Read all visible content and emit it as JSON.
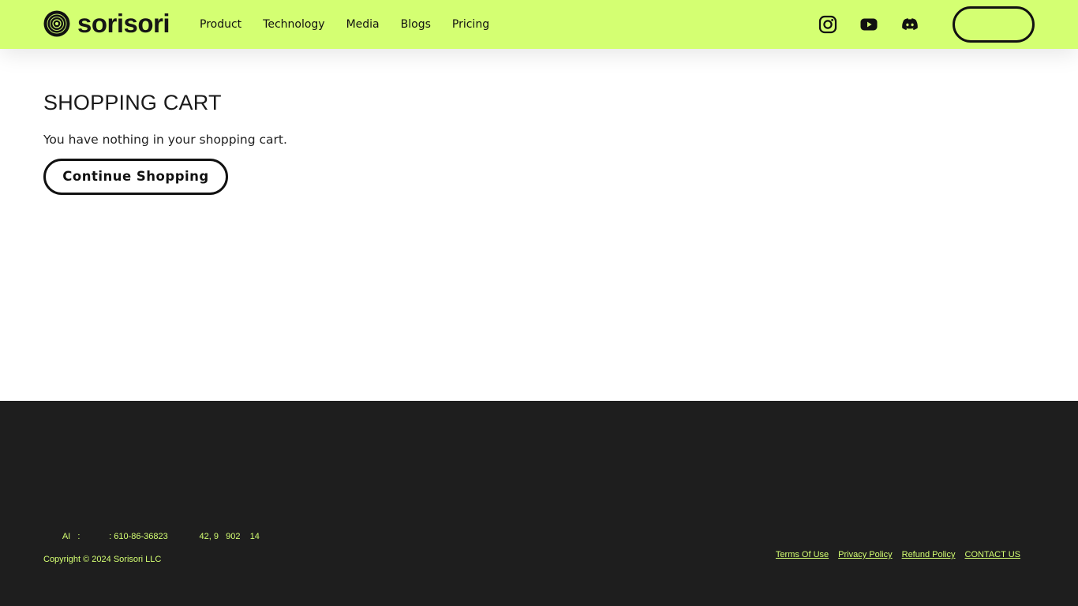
{
  "header": {
    "logo_text": "sorisori",
    "logo_icon": "vinyl-disc-icon",
    "nav": [
      {
        "label": "Product"
      },
      {
        "label": "Technology"
      },
      {
        "label": "Media"
      },
      {
        "label": "Blogs"
      },
      {
        "label": "Pricing"
      }
    ],
    "social": [
      {
        "icon": "instagram-icon"
      },
      {
        "icon": "youtube-icon"
      },
      {
        "icon": "discord-icon"
      }
    ],
    "login_label": ""
  },
  "cart": {
    "title": "SHOPPING CART",
    "empty_message": "You have nothing in your shopping cart.",
    "continue_label": "Continue Shopping"
  },
  "footer": {
    "business_info": "        AI   :            : 610-86-36823             42, 9   902    14",
    "copyright": "Copyright © 2024 Sorisori LLC",
    "links": [
      {
        "label": "Terms Of Use"
      },
      {
        "label": "Privacy Policy"
      },
      {
        "label": "Refund Policy"
      },
      {
        "label": "CONTACT US"
      }
    ]
  },
  "colors": {
    "header_bg": "#d4ff72",
    "footer_bg": "#1e1e1e",
    "footer_text": "#d4ff72"
  }
}
